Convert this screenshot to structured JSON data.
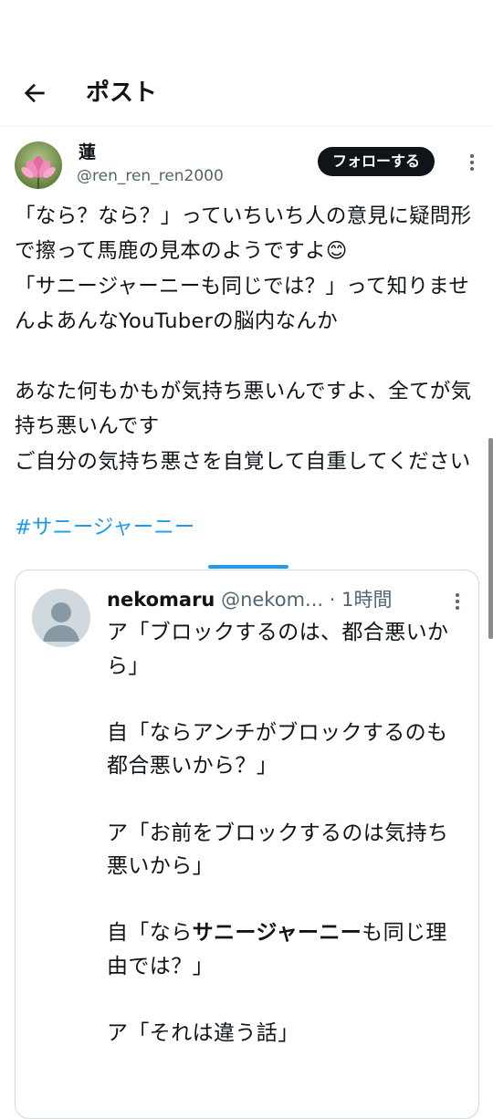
{
  "header": {
    "title": "ポスト"
  },
  "post": {
    "author_name": "蓮",
    "author_handle": "@ren_ren_ren2000",
    "follow_label": "フォローする",
    "text": "「なら？なら？」っていちいち人の意見に疑問形で擦って馬鹿の見本のようですよ😊\n「サニージャーニーも同じでは？」って知りませんよあんなYouTuberの脳内なんか\n\nあなた何もかもが気持ち悪いんですよ、全てが気持ち悪いんです\nご自分の気持ち悪さを自覚して自重してください",
    "hashtag": "#サニージャーニー"
  },
  "quote": {
    "name": "nekomaru",
    "handle": "@nekom...",
    "separator": " · ",
    "time": "1時間",
    "lines": [
      "ア「ブロックするのは、都合悪いから」",
      "自「ならアンチがブロックするのも都合悪いから？」",
      "ア「お前をブロックするのは気持ち悪いから」",
      "自「なら",
      "サニージャーニー",
      "も同じ理由では？」",
      "ア「それは違う話」"
    ]
  },
  "colors": {
    "accent": "#1d9bf0",
    "text": "#0f1419",
    "secondary": "#536471",
    "border": "#cfd9de"
  }
}
